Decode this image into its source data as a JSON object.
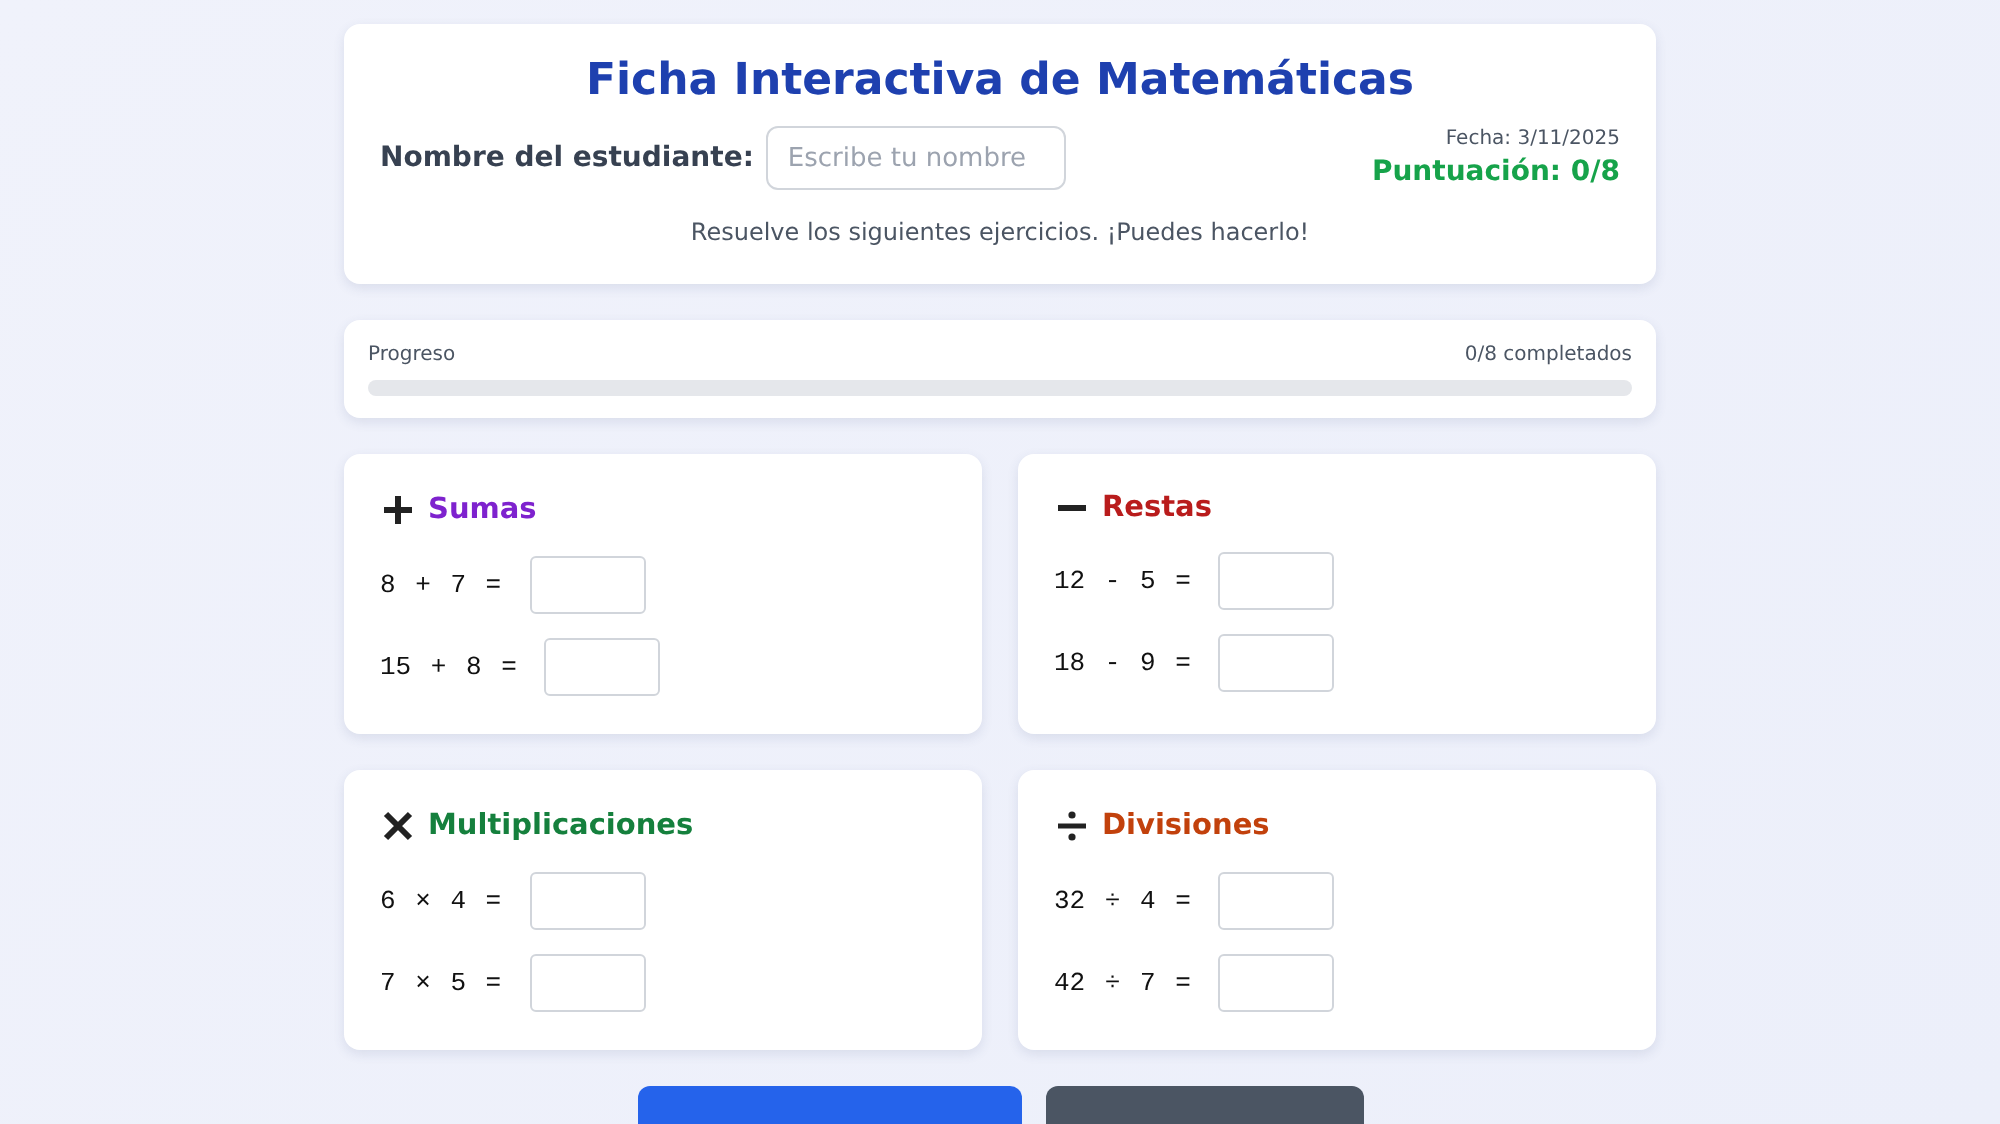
{
  "header": {
    "title": "Ficha Interactiva de Matemáticas",
    "student_label": "Nombre del estudiante:",
    "student_field": {
      "placeholder": "Escribe tu nombre"
    },
    "date": "Fecha: 3/11/2025",
    "score": "Puntuación: 0/8",
    "instructions": "Resuelve los siguientes ejercicios. ¡Puedes hacerlo!"
  },
  "progress": {
    "label": "Progreso",
    "count": "0/8 completados",
    "level": 0
  },
  "sections": [
    {
      "kind": "add",
      "title": "Sumas",
      "color": "#7e22ce",
      "problems": [
        {
          "expression": "8 + 7 ="
        },
        {
          "expression": "15 + 8 ="
        }
      ]
    },
    {
      "kind": "subtract",
      "title": "Restas",
      "color": "#b91c1c",
      "problems": [
        {
          "expression": "12 - 5 ="
        },
        {
          "expression": "18 - 9 ="
        }
      ]
    },
    {
      "kind": "multiply",
      "title": "Multiplicaciones",
      "color": "#15803d",
      "problems": [
        {
          "expression": "6 × 4 ="
        },
        {
          "expression": "7 × 5 ="
        }
      ]
    },
    {
      "kind": "divide",
      "title": "Divisiones",
      "color": "#c2410c",
      "problems": [
        {
          "expression": "32 ÷ 4 ="
        },
        {
          "expression": "42 ÷ 7 ="
        }
      ]
    }
  ],
  "buttons": [
    {
      "kind": "primary"
    },
    {
      "kind": "secondary"
    }
  ]
}
